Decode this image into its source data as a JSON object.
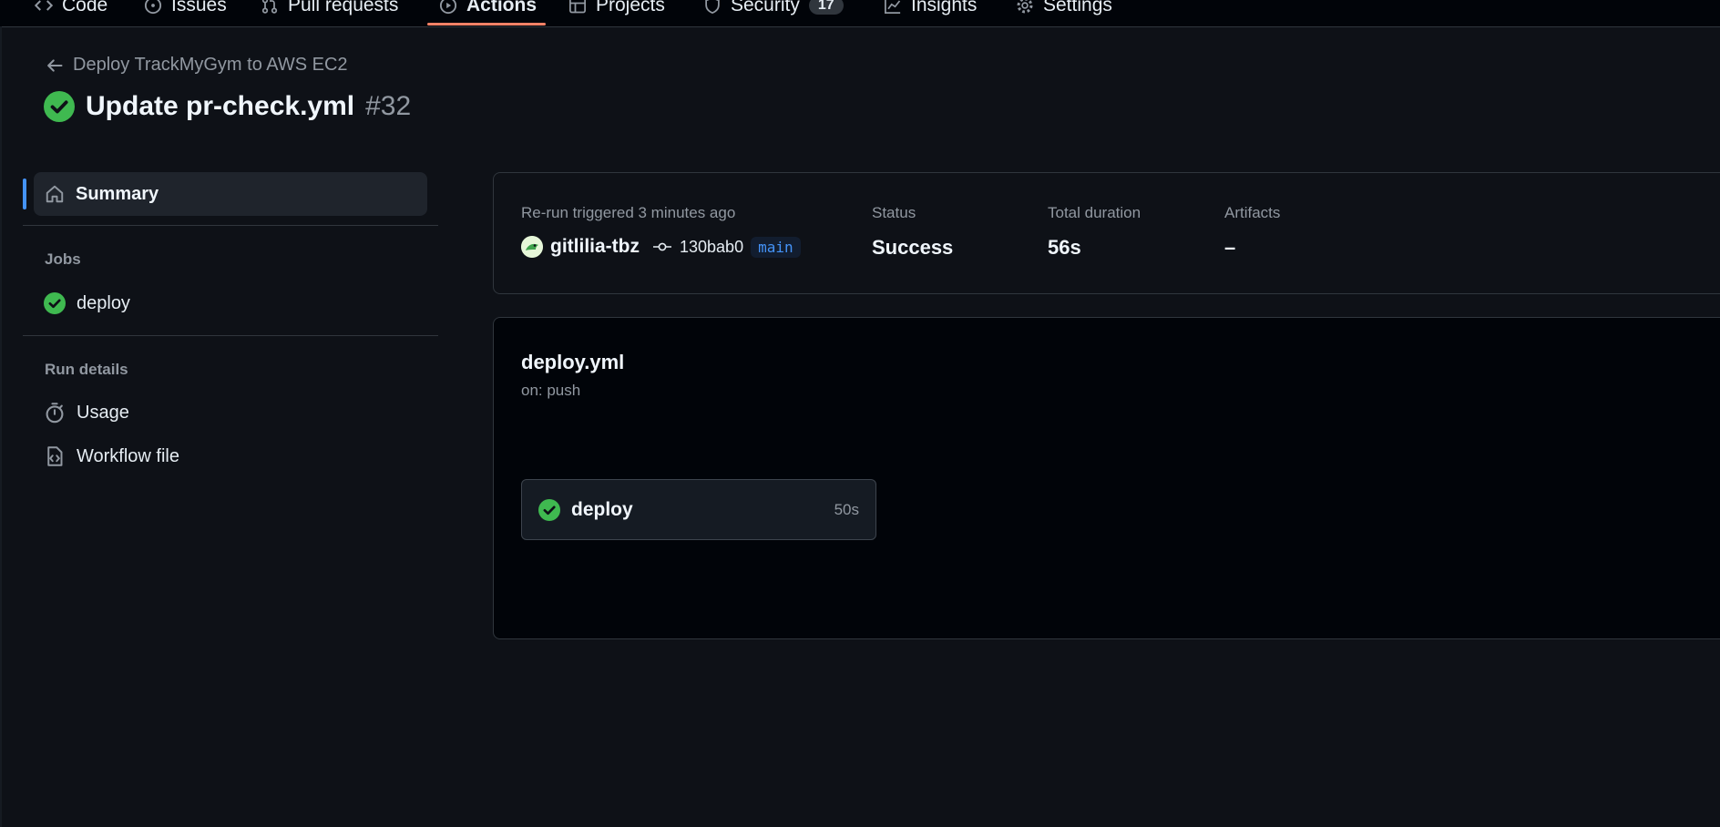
{
  "nav": {
    "tabs": [
      {
        "label": "Code",
        "icon": "code-icon"
      },
      {
        "label": "Issues",
        "icon": "issue-opened-icon"
      },
      {
        "label": "Pull requests",
        "icon": "git-pull-request-icon"
      },
      {
        "label": "Actions",
        "icon": "play-icon",
        "active": true
      },
      {
        "label": "Projects",
        "icon": "table-icon"
      },
      {
        "label": "Security",
        "icon": "shield-icon",
        "counter": "17"
      },
      {
        "label": "Insights",
        "icon": "graph-icon"
      },
      {
        "label": "Settings",
        "icon": "gear-icon"
      }
    ]
  },
  "header": {
    "back_label": "Deploy TrackMyGym to AWS EC2",
    "run_title": "Update pr-check.yml",
    "run_number": "#32"
  },
  "sidebar": {
    "summary_label": "Summary",
    "jobs_heading": "Jobs",
    "jobs": [
      {
        "label": "deploy",
        "status": "success"
      }
    ],
    "details_heading": "Run details",
    "details": [
      {
        "label": "Usage",
        "icon": "stopwatch-icon"
      },
      {
        "label": "Workflow file",
        "icon": "file-code-icon"
      }
    ]
  },
  "summary": {
    "trigger_text": "Re-run triggered 3 minutes ago",
    "actor": "gitlilia-tbz",
    "commit_sha": "130bab0",
    "branch": "main",
    "status_label": "Status",
    "status_value": "Success",
    "duration_label": "Total duration",
    "duration_value": "56s",
    "artifacts_label": "Artifacts",
    "artifacts_value": "–"
  },
  "graph": {
    "workflow_file": "deploy.yml",
    "trigger": "on: push",
    "job": {
      "name": "deploy",
      "duration": "50s",
      "status": "success"
    }
  },
  "colors": {
    "background": "#0e1117",
    "success": "#3fb950",
    "accent": "#4493f8",
    "active_tab": "#f78166"
  }
}
